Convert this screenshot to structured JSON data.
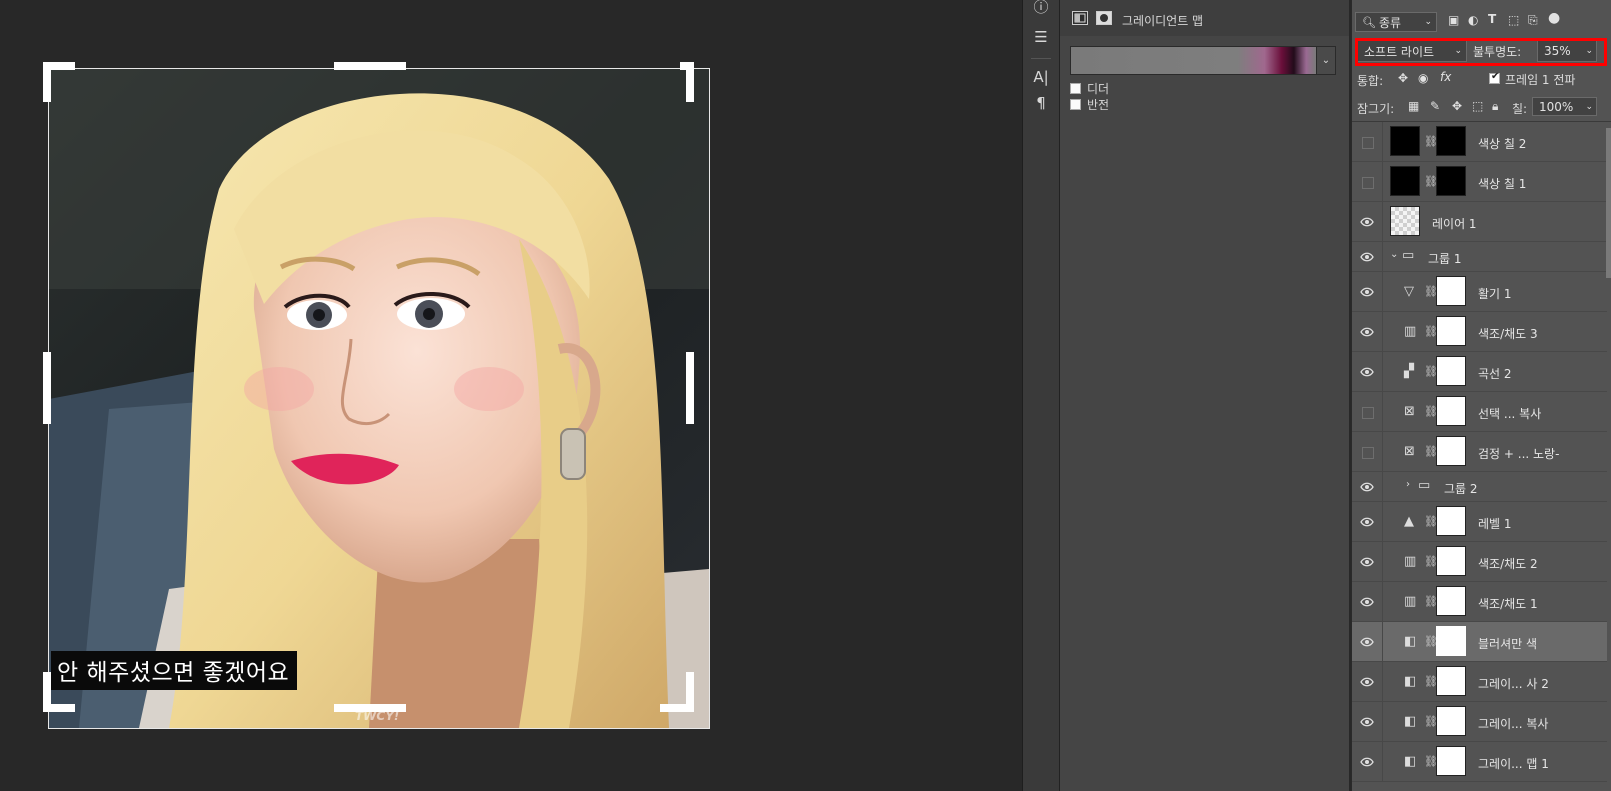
{
  "canvas": {
    "subtitle": "안 해주셨으면 좋겠어요",
    "watermark": "TWCY!"
  },
  "properties": {
    "title": "그레이디언트 맵",
    "options": [
      {
        "label": "디더",
        "checked": false
      },
      {
        "label": "반전",
        "checked": false
      }
    ]
  },
  "layers_panel": {
    "filter_kind": "종류",
    "blend_mode": "소프트 라이트",
    "opacity_label": "불투명도:",
    "opacity_value": "35%",
    "unify_label": "통합:",
    "propagate_label": "프레임 1 전파",
    "propagate_checked": true,
    "lock_label": "잠그기:",
    "fill_label": "칠:",
    "fill_value": "100%",
    "layers": [
      {
        "name": "색상 칠 2",
        "visible": false,
        "kind": "fill-black"
      },
      {
        "name": "색상 칠 1",
        "visible": false,
        "kind": "fill-black"
      },
      {
        "name": "레이어 1",
        "visible": true,
        "kind": "pixel"
      },
      {
        "name": "그룹 1",
        "visible": true,
        "kind": "group-open"
      },
      {
        "name": "활기 1",
        "visible": true,
        "kind": "vibrance"
      },
      {
        "name": "색조/채도 3",
        "visible": true,
        "kind": "hue"
      },
      {
        "name": "곡선 2",
        "visible": true,
        "kind": "curves"
      },
      {
        "name": "선택 ... 복사",
        "visible": false,
        "kind": "selective"
      },
      {
        "name": "검정 + ... 노랑-",
        "visible": false,
        "kind": "selective"
      },
      {
        "name": "그룹 2",
        "visible": true,
        "kind": "group-closed"
      },
      {
        "name": "레벨 1",
        "visible": true,
        "kind": "levels"
      },
      {
        "name": "색조/채도 2",
        "visible": true,
        "kind": "hue"
      },
      {
        "name": "색조/채도 1",
        "visible": true,
        "kind": "hue"
      },
      {
        "name": "블러셔만 색",
        "visible": true,
        "kind": "gradient",
        "selected": true
      },
      {
        "name": "그레이... 사 2",
        "visible": true,
        "kind": "gradient"
      },
      {
        "name": "그레이... 복사",
        "visible": true,
        "kind": "gradient"
      },
      {
        "name": "그레이... 맵 1",
        "visible": true,
        "kind": "gradient"
      }
    ]
  }
}
